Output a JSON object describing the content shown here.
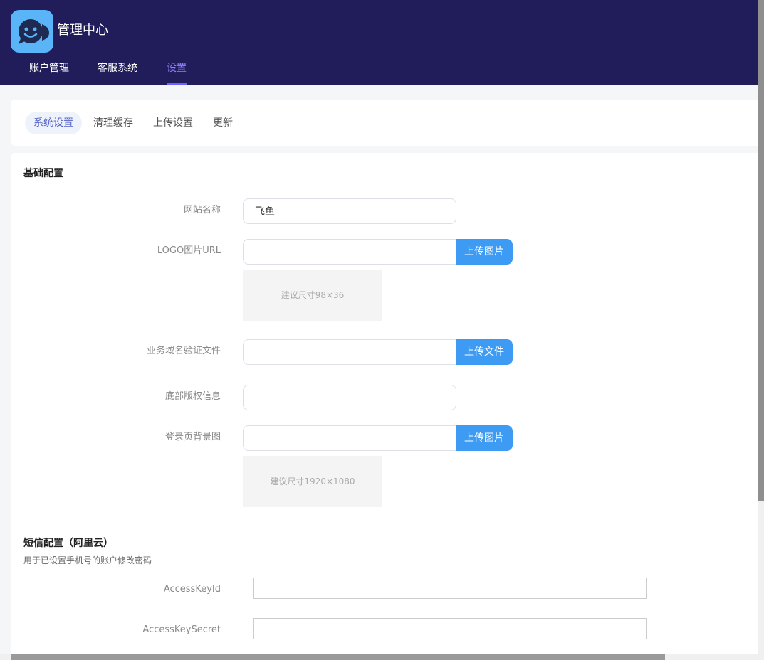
{
  "header": {
    "app_title": "管理中心",
    "nav": [
      {
        "label": "账户管理"
      },
      {
        "label": "客服系统"
      },
      {
        "label": "设置",
        "active": true
      }
    ]
  },
  "tabs": [
    {
      "label": "系统设置",
      "active": true
    },
    {
      "label": "清理缓存"
    },
    {
      "label": "上传设置"
    },
    {
      "label": "更新"
    }
  ],
  "basic": {
    "title": "基础配置",
    "site_name_label": "网站名称",
    "site_name_value": "飞鱼",
    "logo_label": "LOGO图片URL",
    "logo_value": "",
    "logo_button": "上传图片",
    "logo_hint": "建议尺寸98×36",
    "domain_file_label": "业务域名验证文件",
    "domain_file_value": "",
    "domain_file_button": "上传文件",
    "copyright_label": "底部版权信息",
    "copyright_value": "",
    "login_bg_label": "登录页背景图",
    "login_bg_value": "",
    "login_bg_button": "上传图片",
    "login_bg_hint": "建议尺寸1920×1080"
  },
  "sms": {
    "title": "短信配置（阿里云）",
    "desc": "用于已设置手机号的账户修改密码",
    "access_key_id_label": "AccessKeyId",
    "access_key_id_value": "",
    "access_key_secret_label": "AccessKeySecret",
    "access_key_secret_value": ""
  },
  "colors": {
    "header_bg": "#211d5a",
    "accent": "#6b63ff",
    "button_blue": "#3e9bf4",
    "logo_bg": "#5ab4f8"
  }
}
